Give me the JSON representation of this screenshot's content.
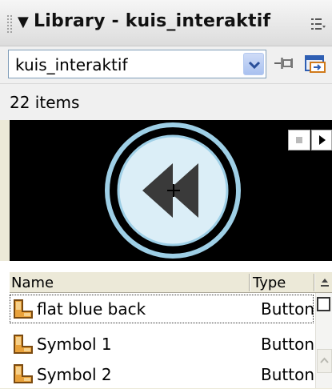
{
  "panel": {
    "title": "Library - kuis_interaktif",
    "collapse_icon": "triangle-down-icon",
    "options_icon": "panel-options-icon"
  },
  "library_select": {
    "value": "kuis_interaktif",
    "pin_icon": "pin-icon",
    "new_library_icon": "new-library-panel-icon"
  },
  "item_count": "22 items",
  "preview": {
    "stop_icon": "stop-icon",
    "play_icon": "play-icon",
    "symbol_icon": "rewind-icon"
  },
  "columns": {
    "name": "Name",
    "type": "Type",
    "sort_icon": "sort-direction-icon"
  },
  "items": [
    {
      "name": "flat blue back",
      "type": "Button",
      "icon": "button-symbol-icon"
    },
    {
      "name": "Symbol 1",
      "type": "Button",
      "icon": "button-symbol-icon"
    },
    {
      "name": "Symbol 2",
      "type": "Button",
      "icon": "button-symbol-icon"
    }
  ],
  "colors": {
    "preview_ring": "#9ecfe6",
    "preview_fill": "#dbeef7",
    "arrow": "#3a3a3a"
  }
}
